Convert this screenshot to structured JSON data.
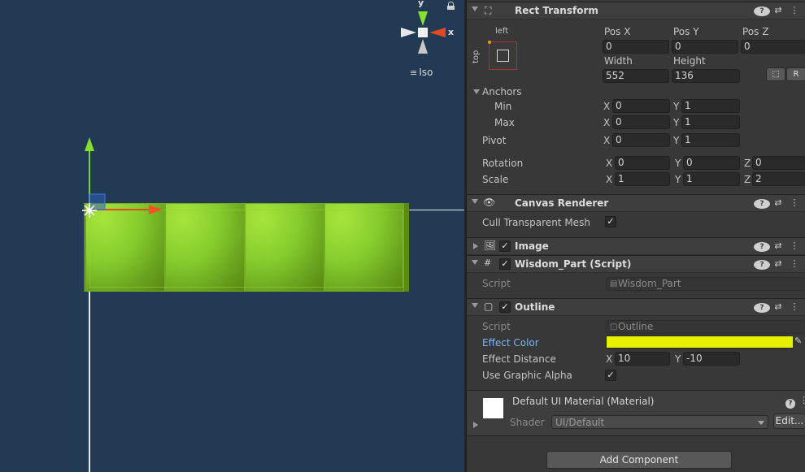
{
  "scene": {
    "orientation_label": "Iso",
    "gizmo_y": "y",
    "gizmo_x": "x",
    "blocks": 4
  },
  "rect_transform": {
    "title": "Rect Transform",
    "anchor_preset_h": "left",
    "anchor_preset_v": "top",
    "pos_x_label": "Pos X",
    "pos_x": "0",
    "pos_y_label": "Pos Y",
    "pos_y": "0",
    "pos_z_label": "Pos Z",
    "pos_z": "0",
    "width_label": "Width",
    "width": "552",
    "height_label": "Height",
    "height": "136",
    "raw_button": "R",
    "anchors_label": "Anchors",
    "min_label": "Min",
    "min_x": "0",
    "min_y": "1",
    "max_label": "Max",
    "max_x": "0",
    "max_y": "1",
    "pivot_label": "Pivot",
    "pivot_x": "0",
    "pivot_y": "1",
    "rotation_label": "Rotation",
    "rot_x": "0",
    "rot_y": "0",
    "rot_z": "0",
    "scale_label": "Scale",
    "scale_x": "1",
    "scale_y": "1",
    "scale_z": "2",
    "x": "X",
    "y": "Y",
    "z": "Z"
  },
  "canvas_renderer": {
    "title": "Canvas Renderer",
    "cull_label": "Cull Transparent Mesh",
    "cull_checked": "✓"
  },
  "image": {
    "title": "Image",
    "enabled": "✓"
  },
  "wisdom_part": {
    "title": "Wisdom_Part (Script)",
    "enabled": "✓",
    "script_label": "Script",
    "script_value": "Wisdom_Part"
  },
  "outline": {
    "title": "Outline",
    "enabled": "✓",
    "script_label": "Script",
    "script_value": "Outline",
    "effect_color_label": "Effect Color",
    "effect_color": "#e6f000",
    "effect_distance_label": "Effect Distance",
    "dist_x": "10",
    "dist_y": "-10",
    "use_graphic_alpha_label": "Use Graphic Alpha",
    "use_graphic_alpha": "✓"
  },
  "material": {
    "title": "Default UI Material (Material)",
    "shader_label": "Shader",
    "shader_value": "UI/Default",
    "edit_button": "Edit..."
  },
  "add_component": "Add Component"
}
